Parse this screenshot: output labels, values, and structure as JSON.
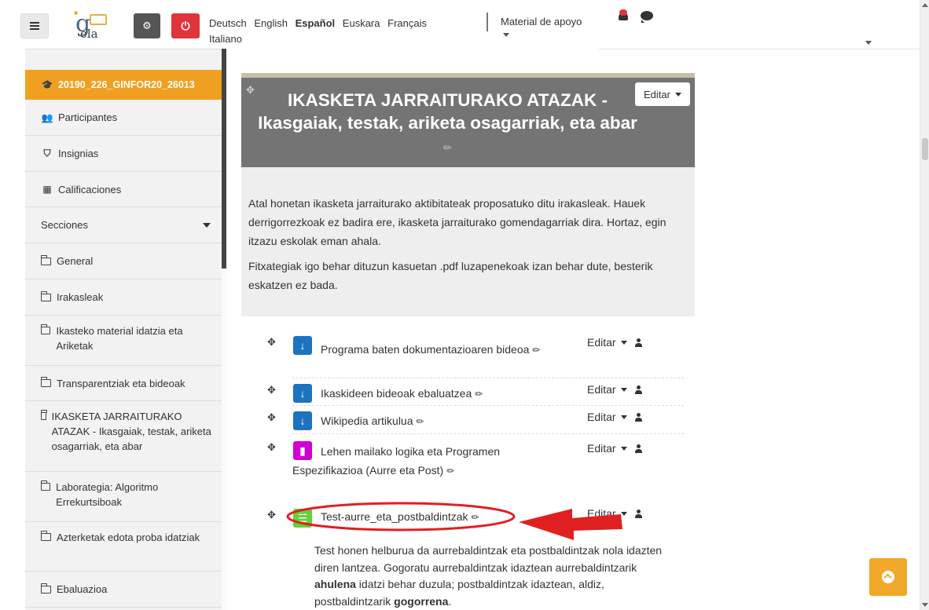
{
  "navbar": {
    "languages": [
      "Deutsch",
      "English",
      "Español",
      "Euskara",
      "Français",
      "Italiano"
    ],
    "active_language": "Español",
    "support_menu": "Material de apoyo",
    "gear_glyph": "⚙",
    "power_glyph": "⏻"
  },
  "logo": {
    "letter": "g",
    "text": "ela"
  },
  "drawer": {
    "course_icon": "🎓",
    "course": "20190_226_GINFOR20_26013",
    "participants": "Participantes",
    "badges": "Insignias",
    "grades": "Calificaciones",
    "sections_label": "Secciones",
    "sections": [
      "General",
      "Irakasleak",
      "Ikasteko material idatzia eta Ariketak",
      "Transparentziak eta bideoak",
      "IKASKETA JARRAITURAKO ATAZAK - Ikasgaiak, testak, ariketa osagarriak, eta abar",
      "Laborategia: Algoritmo Errekurtsiboak",
      "Azterketak edota proba idatziak",
      "Ebaluazioa"
    ]
  },
  "section": {
    "title": "IKASKETA JARRAITURAKO ATAZAK - Ikasgaiak, testak, ariketa osagarriak, eta abar",
    "edit": "Editar",
    "summary_p1": "Atal honetan ikasketa jarraiturako aktibitateak proposatuko ditu irakasleak. Hauek derrigorrezkoak ez badira ere, ikasketa jarraiturako gomendagarriak dira. Hortaz, egin itzazu eskolak eman ahala.",
    "summary_p2": "Fitxategiak igo behar dituzun kasuetan .pdf luzapenekoak izan behar dute, besterik eskatzen ez bada."
  },
  "activities": [
    {
      "name": "Programa baten dokumentazioaren bideoa",
      "type": "assignment",
      "edit": "Editar",
      "icon": "↓"
    },
    {
      "name": "Ikaskideen bideoak ebaluatzea",
      "type": "assignment",
      "edit": "Editar",
      "icon": "↓"
    },
    {
      "name": "Wikipedia artikulua",
      "type": "assignment",
      "edit": "Editar",
      "icon": "↓"
    },
    {
      "name": "Lehen mailako logika eta Programen Espezifikazioa (Aurre eta Post)",
      "type": "book",
      "edit": "Editar",
      "icon": "▮"
    },
    {
      "name": "Test-aurre_eta_postbaldintzak",
      "type": "quiz",
      "edit": "Editar",
      "icon": "☰"
    }
  ],
  "test_description": {
    "part1": "Test honen helburua da aurrebaldintzak eta postbaldintzak nola idazten diren lantzea. Gogoratu aurrebaldintzak idaztean aurrebaldintzarik ",
    "bold1": "ahulena",
    "part2": " idatzi behar duzula; postbaldintzak idaztean, aldiz, postbaldintzarik ",
    "bold2": "gogorrena",
    "part3": "."
  },
  "colors": {
    "accent_orange": "#f0a020",
    "header_grey": "#747474",
    "annotation_red": "#e02020"
  }
}
